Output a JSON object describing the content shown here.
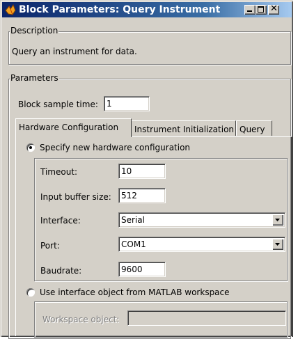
{
  "window": {
    "title": "Block Parameters: Query Instrument"
  },
  "description": {
    "legend": "Description",
    "text": "Query an instrument for data."
  },
  "parameters": {
    "legend": "Parameters",
    "sample_time_label": "Block sample time:",
    "sample_time_value": "1"
  },
  "tabs": [
    {
      "label": "Hardware Configuration",
      "active": true
    },
    {
      "label": "Instrument Initialization",
      "active": false
    },
    {
      "label": "Query",
      "active": false
    }
  ],
  "hardware": {
    "specify_new_label": "Specify new hardware configuration",
    "specify_new_selected": true,
    "timeout_label": "Timeout:",
    "timeout_value": "10",
    "input_buffer_label": "Input buffer size:",
    "input_buffer_value": "512",
    "interface_label": "Interface:",
    "interface_value": "Serial",
    "port_label": "Port:",
    "port_value": "COM1",
    "baudrate_label": "Baudrate:",
    "baudrate_value": "9600",
    "use_interface_label": "Use interface object from MATLAB workspace",
    "use_interface_selected": false,
    "workspace_object_label": "Workspace object:",
    "workspace_object_value": ""
  }
}
